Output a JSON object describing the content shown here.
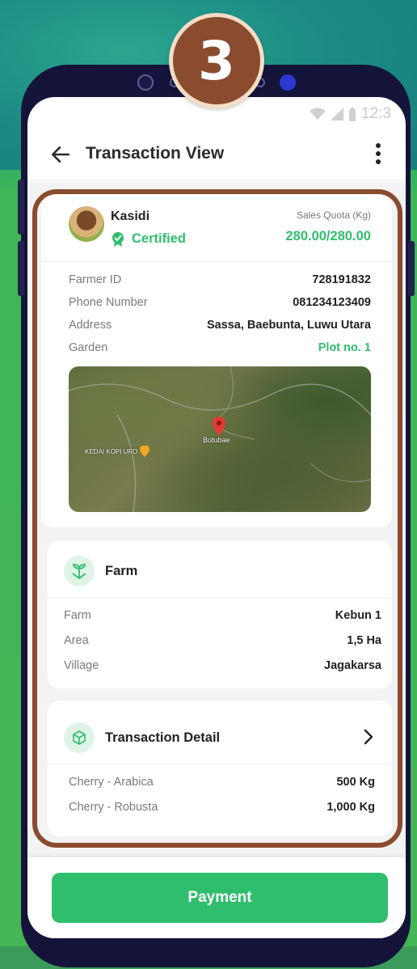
{
  "step_badge": "3",
  "status_bar": {
    "time": "12:3"
  },
  "appbar": {
    "title": "Transaction View"
  },
  "farmer": {
    "name": "Kasidi",
    "certified_label": "Certified",
    "quota_label": "Sales Quota (Kg)",
    "quota_value": "280.00/280.00",
    "rows": [
      {
        "label": "Farmer ID",
        "value": "728191832"
      },
      {
        "label": "Phone Number",
        "value": "081234123409"
      },
      {
        "label": "Address",
        "value": "Sassa, Baebunta, Luwu Utara"
      },
      {
        "label": "Garden",
        "value": "Plot no. 1"
      }
    ],
    "map": {
      "pin_label": "Butubae",
      "poi_label": "KEDAI KOPI URO"
    }
  },
  "farm": {
    "title": "Farm",
    "rows": [
      {
        "label": "Farm",
        "value": "Kebun 1"
      },
      {
        "label": "Area",
        "value": "1,5 Ha"
      },
      {
        "label": "Village",
        "value": "Jagakarsa"
      }
    ]
  },
  "transaction": {
    "title": "Transaction Detail",
    "rows": [
      {
        "label": "Cherry - Arabica",
        "value": "500 Kg"
      },
      {
        "label": "Cherry - Robusta",
        "value": "1,000 Kg"
      }
    ]
  },
  "payment_button": "Payment",
  "colors": {
    "accent_green": "#2fbe6e",
    "highlight_brown": "#8a4b2e",
    "phone_frame": "#14143a"
  }
}
